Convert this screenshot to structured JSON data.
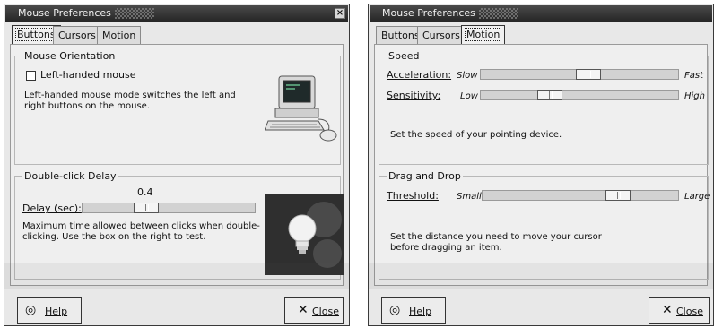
{
  "colors": {
    "titlebar": "#2e2e2e",
    "window_bg": "#e8e8e8",
    "slider_track": "#d2d2d2"
  },
  "left_window": {
    "title": "Mouse Preferences",
    "close_glyph": "×",
    "tabs": [
      {
        "label": "Buttons",
        "active": true
      },
      {
        "label": "Cursors",
        "active": false
      },
      {
        "label": "Motion",
        "active": false
      }
    ],
    "orientation": {
      "title": "Mouse Orientation",
      "checkbox_label": "Left-handed mouse",
      "checked": false,
      "desc_line1": "Left-handed mouse mode switches the left and",
      "desc_line2": "right buttons on the mouse.",
      "image_icon": "computer-mouse-illustration"
    },
    "double_click": {
      "title": "Double-click Delay",
      "value_text": "0.4",
      "slider_label": "Delay (sec):",
      "slider_value_fraction": 0.35,
      "desc_line1": "Maximum time allowed between clicks when double-",
      "desc_line2": "clicking.  Use the box on the right to test.",
      "test_icon": "lightbulb-icon"
    },
    "help_button": "Help",
    "close_button": "Close"
  },
  "right_window": {
    "title": "Mouse Preferences",
    "tabs": [
      {
        "label": "Buttons",
        "active": false
      },
      {
        "label": "Cursors",
        "active": false
      },
      {
        "label": "Motion",
        "active": true
      }
    ],
    "speed": {
      "title": "Speed",
      "acceleration_label": "Acceleration:",
      "acceleration_min": "Slow",
      "acceleration_max": "Fast",
      "acceleration_fraction": 0.55,
      "sensitivity_label": "Sensitivity:",
      "sensitivity_min": "Low",
      "sensitivity_max": "High",
      "sensitivity_fraction": 0.33,
      "desc": "Set the speed of your pointing device."
    },
    "drag_drop": {
      "title": "Drag and Drop",
      "threshold_label": "Threshold:",
      "threshold_min": "Small",
      "threshold_max": "Large",
      "threshold_fraction": 0.72,
      "desc_line1": "Set the distance you need to move your cursor",
      "desc_line2": "before dragging an item."
    },
    "help_button": "Help",
    "close_button": "Close"
  }
}
